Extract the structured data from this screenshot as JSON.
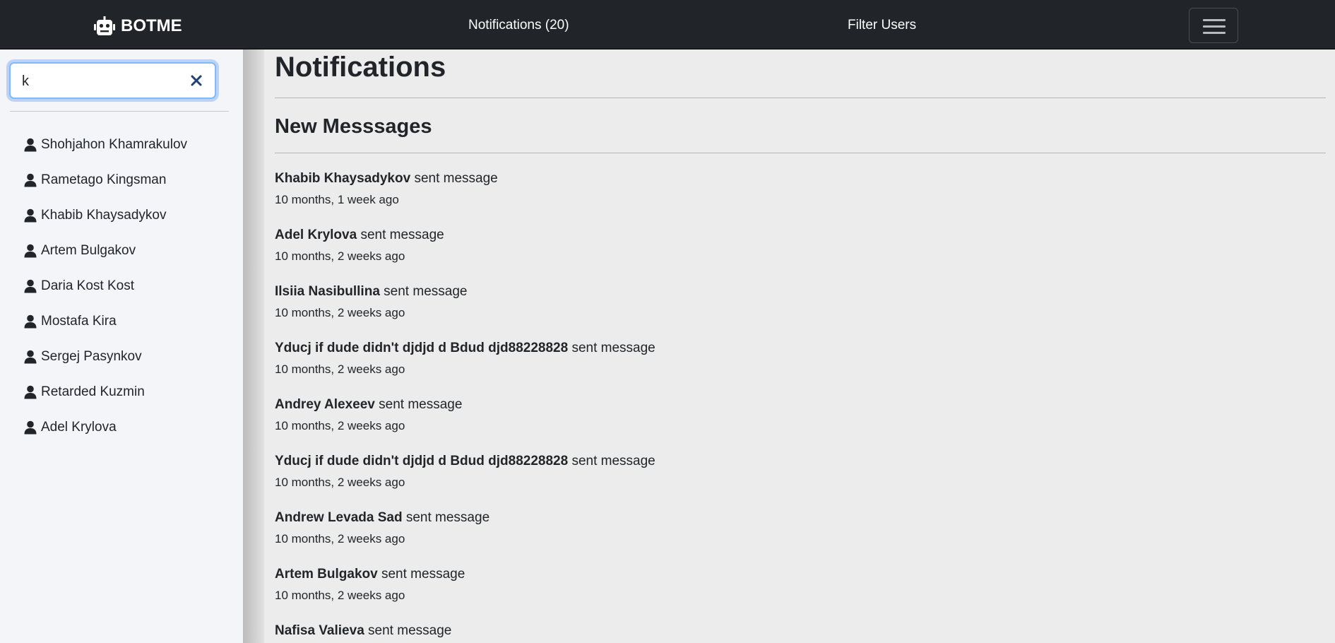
{
  "navbar": {
    "brand": "BOTME",
    "notifications_label": "Notifications (20)",
    "filter_users_label": "Filter Users"
  },
  "sidebar": {
    "search": {
      "value": "k",
      "placeholder": ""
    },
    "users": [
      "Shohjahon Khamrakulov",
      "Rametago Kingsman",
      "Khabib Khaysadykov",
      "Artem Bulgakov",
      "Daria Kost Kost",
      "Mostafa Kira",
      "Sergej Pasynkov",
      "Retarded Kuzmin",
      "Adel Krylova"
    ]
  },
  "main": {
    "title": "Notifications",
    "section_title": "New Messsages",
    "suffix": "sent message",
    "messages": [
      {
        "name": "Khabib Khaysadykov",
        "time": "10 months, 1 week ago"
      },
      {
        "name": "Adel Krylova",
        "time": "10 months, 2 weeks ago"
      },
      {
        "name": "Ilsiia Nasibullina",
        "time": "10 months, 2 weeks ago"
      },
      {
        "name": "Yducj if dude didn't djdjd d Bdud djd88228828",
        "time": "10 months, 2 weeks ago"
      },
      {
        "name": "Andrey Alexeev",
        "time": "10 months, 2 weeks ago"
      },
      {
        "name": "Yducj if dude didn't djdjd d Bdud djd88228828",
        "time": "10 months, 2 weeks ago"
      },
      {
        "name": "Andrew Levada Sad",
        "time": "10 months, 2 weeks ago"
      },
      {
        "name": "Artem Bulgakov",
        "time": "10 months, 2 weeks ago"
      },
      {
        "name": "Nafisa Valieva",
        "time": ""
      }
    ]
  },
  "icons": {
    "brand": "robot-icon",
    "user": "person-icon",
    "clear": "close-icon",
    "menu": "hamburger-menu-icon"
  },
  "colors": {
    "navbar_bg": "#212529",
    "sidebar_bg": "#f3f5f8",
    "content_bg": "#ececec",
    "focus_border": "#86b7fe",
    "clear_icon": "#1f3f75"
  }
}
